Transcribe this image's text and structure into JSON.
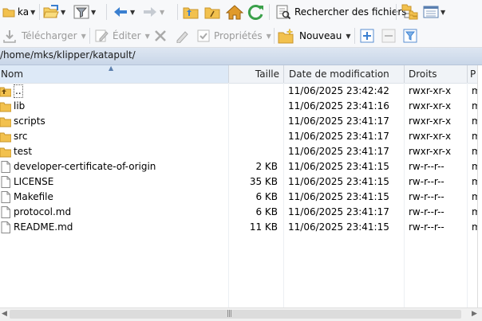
{
  "toolbar1": {
    "drive_label": "ka",
    "search_files_label": "Rechercher des fichiers"
  },
  "toolbar2": {
    "download_label": "Télécharger",
    "edit_label": "Éditer",
    "properties_label": "Propriétés",
    "new_label": "Nouveau"
  },
  "path": "/home/mks/klipper/katapult/",
  "columns": {
    "name": "Nom",
    "size": "Taille",
    "modified": "Date de modification",
    "rights": "Droits",
    "owner": "P"
  },
  "files": [
    {
      "name": "..",
      "size": "",
      "modified": "11/06/2025 23:42:42",
      "rights": "rwxr-xr-x",
      "owner": "m",
      "type": "parent"
    },
    {
      "name": "lib",
      "size": "",
      "modified": "11/06/2025 23:41:16",
      "rights": "rwxr-xr-x",
      "owner": "m",
      "type": "folder"
    },
    {
      "name": "scripts",
      "size": "",
      "modified": "11/06/2025 23:41:17",
      "rights": "rwxr-xr-x",
      "owner": "m",
      "type": "folder"
    },
    {
      "name": "src",
      "size": "",
      "modified": "11/06/2025 23:41:17",
      "rights": "rwxr-xr-x",
      "owner": "m",
      "type": "folder"
    },
    {
      "name": "test",
      "size": "",
      "modified": "11/06/2025 23:41:17",
      "rights": "rwxr-xr-x",
      "owner": "m",
      "type": "folder"
    },
    {
      "name": "developer-certificate-of-origin",
      "size": "2 KB",
      "modified": "11/06/2025 23:41:15",
      "rights": "rw-r--r--",
      "owner": "m",
      "type": "file"
    },
    {
      "name": "LICENSE",
      "size": "35 KB",
      "modified": "11/06/2025 23:41:15",
      "rights": "rw-r--r--",
      "owner": "m",
      "type": "file"
    },
    {
      "name": "Makefile",
      "size": "6 KB",
      "modified": "11/06/2025 23:41:15",
      "rights": "rw-r--r--",
      "owner": "m",
      "type": "file"
    },
    {
      "name": "protocol.md",
      "size": "6 KB",
      "modified": "11/06/2025 23:41:17",
      "rights": "rw-r--r--",
      "owner": "m",
      "type": "file"
    },
    {
      "name": "README.md",
      "size": "11 KB",
      "modified": "11/06/2025 23:41:15",
      "rights": "rw-r--r--",
      "owner": "m",
      "type": "file"
    }
  ],
  "colors": {
    "folder": "#f2c14e",
    "accent_blue": "#3a7fd0",
    "green": "#3aa04a",
    "path_bg": "#d3deec"
  }
}
